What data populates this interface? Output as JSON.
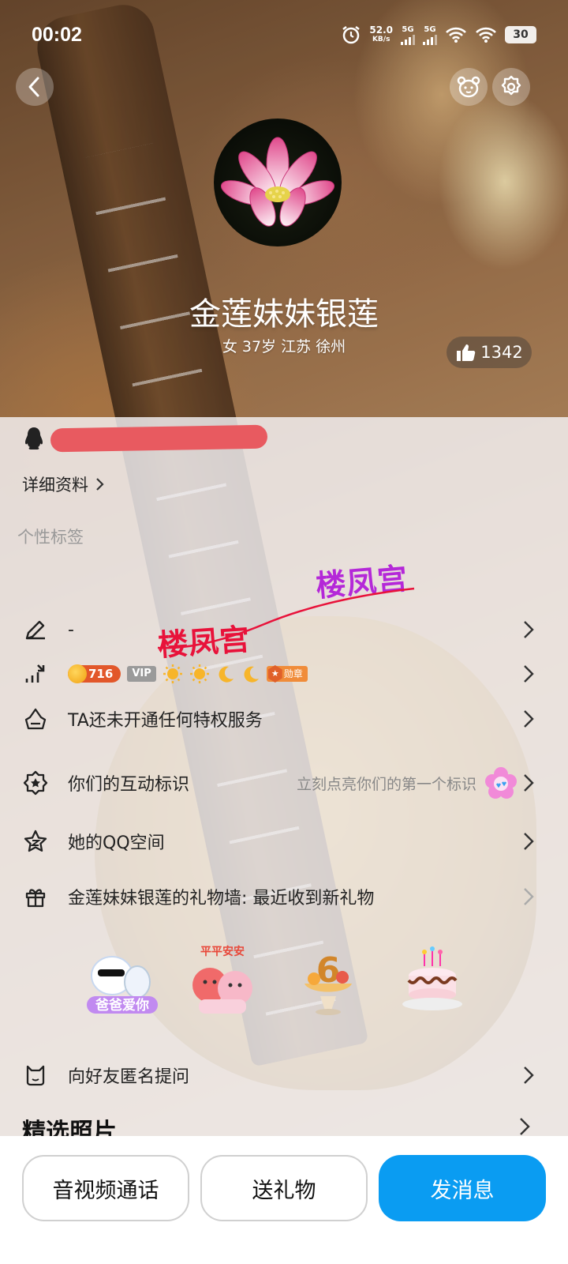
{
  "status_bar": {
    "time": "00:02",
    "net_speed_value": "52.0",
    "net_speed_unit": "KB/s",
    "sim1": "5G",
    "sim2": "5G",
    "battery": "30"
  },
  "profile": {
    "nickname": "金莲妹妹银莲",
    "sub_info": "女 37岁 江苏 徐州",
    "likes": "1342"
  },
  "info": {
    "detail_link": "详细资料",
    "tags_label": "个性标签",
    "signature": "-",
    "level_coins": "716",
    "vip_label": "VIP",
    "medal_label": "勋章",
    "privilege": "TA还未开通任何特权服务",
    "interaction_label": "你们的互动标识",
    "interaction_hint": "立刻点亮你们的第一个标识",
    "qzone": "她的QQ空间",
    "gift_wall": "金莲妹妹银莲的礼物墙: 最近收到新礼物",
    "anonymous_question": "向好友匿名提问",
    "photos_title": "精选照片"
  },
  "gifts": [
    {
      "name": "爸爸爱你"
    },
    {
      "name": "平平安安"
    },
    {
      "name": "6"
    },
    {
      "name": "cake"
    }
  ],
  "watermarks": {
    "text1": "楼凤宫",
    "text2": "楼凤宫",
    "color1": "#e8123a",
    "color2": "#b428d8"
  },
  "bottom_bar": {
    "call": "音视频通话",
    "gift": "送礼物",
    "message": "发消息"
  },
  "colors": {
    "primary": "#0a9cf2"
  }
}
